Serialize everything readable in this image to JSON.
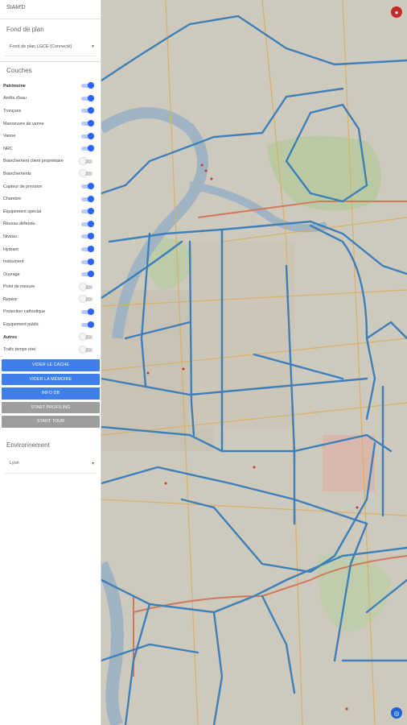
{
  "app": {
    "title": "SIAM'D"
  },
  "basemap": {
    "heading": "Fond de plan",
    "selected": "Fond de plan LGCE (Connecté)"
  },
  "layers": {
    "heading": "Couches",
    "items": [
      {
        "label": "Patrimoine",
        "on": true,
        "group": true
      },
      {
        "label": "Arrêts d'eau",
        "on": true
      },
      {
        "label": "Tronçons",
        "on": true
      },
      {
        "label": "Manoeuvre de vanne",
        "on": true
      },
      {
        "label": "Vanne",
        "on": true
      },
      {
        "label": "NRC",
        "on": true
      },
      {
        "label": "Branchement client propriétaire",
        "on": false
      },
      {
        "label": "Branchements",
        "on": false
      },
      {
        "label": "Capteur de pression",
        "on": true
      },
      {
        "label": "Chambre",
        "on": true
      },
      {
        "label": "Équipement spécial",
        "on": true
      },
      {
        "label": "Réseau défendu",
        "on": true
      },
      {
        "label": "Niveau",
        "on": true
      },
      {
        "label": "Hydrant",
        "on": true
      },
      {
        "label": "Instrument",
        "on": true
      },
      {
        "label": "Ouvrage",
        "on": true
      },
      {
        "label": "Point de mesure",
        "on": false
      },
      {
        "label": "Repère",
        "on": false
      },
      {
        "label": "Protection cathodique",
        "on": true
      },
      {
        "label": "Équipement public",
        "on": true
      },
      {
        "label": "Autres",
        "on": false,
        "group": true
      },
      {
        "label": "Trafic temps réel",
        "on": false
      }
    ]
  },
  "buttons": {
    "clear_cache": "VIDER LE CACHE",
    "clear_memory": "VIDER LA MÉMOIRE",
    "info_db": "INFO DB",
    "start_profiling": "START PROFILING",
    "start_tour": "START TOUR"
  },
  "environment": {
    "heading": "Environnement",
    "selected": "Lyon"
  },
  "colors": {
    "network": "#3d7fb8",
    "accent": "#2962ff",
    "button": "#3f7fea",
    "river": "#9fb3c3",
    "park": "#b8c9a3",
    "major_road": "#d9b064",
    "highway": "#d07a5a",
    "fab_top": "#c62828",
    "fab_bottom": "#1e63d6"
  },
  "icons": {
    "top_button": "map-marker-icon",
    "bottom_button": "locate-icon"
  }
}
